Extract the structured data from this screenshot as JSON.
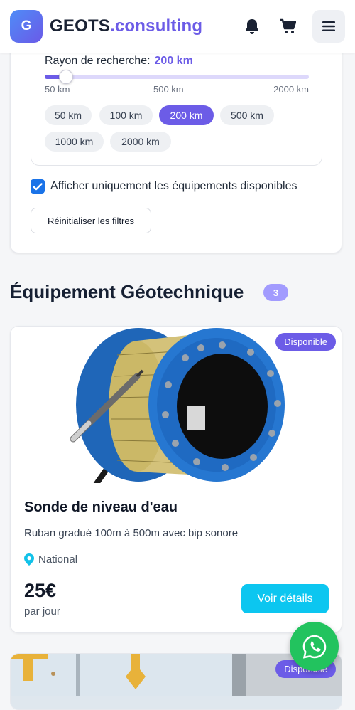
{
  "header": {
    "logo_letter": "G",
    "brand_main": "GEOTS",
    "brand_accent": ".consulting",
    "icons": [
      "bell-icon",
      "cart-icon",
      "menu-icon"
    ]
  },
  "filters": {
    "radius_label": "Rayon de recherche:",
    "radius_value": "200 km",
    "slider_value_fraction": 0.08,
    "slider_min_label": "50 km",
    "slider_mid_label": "500 km",
    "slider_max_label": "2000 km",
    "chips": [
      {
        "label": "50 km",
        "active": false
      },
      {
        "label": "100 km",
        "active": false
      },
      {
        "label": "200 km",
        "active": true
      },
      {
        "label": "500 km",
        "active": false
      },
      {
        "label": "1000 km",
        "active": false
      },
      {
        "label": "2000 km",
        "active": false
      }
    ],
    "available_only_label": "Afficher uniquement les équipements disponibles",
    "available_only_checked": true,
    "reset_label": "Réinitialiser les filtres"
  },
  "section": {
    "title": "Équipement Géotechnique",
    "count": "3"
  },
  "products": [
    {
      "badge": "Disponible",
      "title": "Sonde de niveau d'eau",
      "description": "Ruban gradué 100m à 500m avec bip sonore",
      "location": "National",
      "price": "25€",
      "price_unit": "par jour",
      "details_label": "Voir détails"
    },
    {
      "badge": "Disponible"
    }
  ],
  "colors": {
    "accent": "#6c5ce7",
    "cta": "#0cc6f0",
    "whatsapp": "#22c35e"
  }
}
